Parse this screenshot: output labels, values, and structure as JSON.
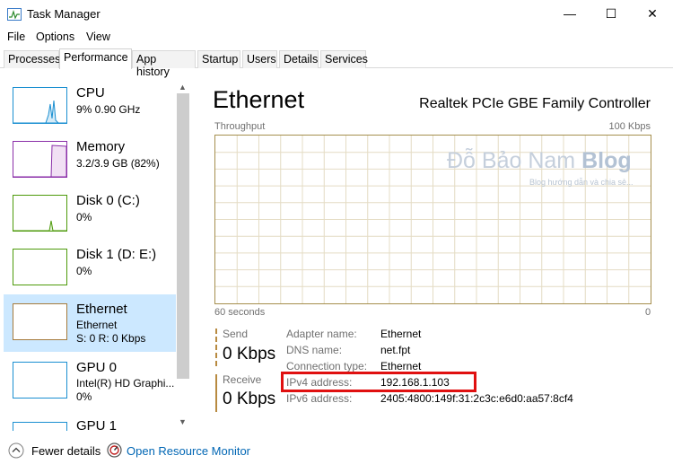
{
  "window": {
    "title": "Task Manager",
    "controls": {
      "minimize": "—",
      "maximize": "☐",
      "close": "✕"
    }
  },
  "menu": [
    "File",
    "Options",
    "View"
  ],
  "tabs": [
    {
      "label": "Processes",
      "active": false
    },
    {
      "label": "Performance",
      "active": true
    },
    {
      "label": "App history",
      "active": false
    },
    {
      "label": "Startup",
      "active": false
    },
    {
      "label": "Users",
      "active": false
    },
    {
      "label": "Details",
      "active": false
    },
    {
      "label": "Services",
      "active": false
    }
  ],
  "sidebar": {
    "items": [
      {
        "name": "CPU",
        "sub1": "9% 0.90 GHz",
        "sub2": "",
        "color": "#1a8fd1",
        "usage": 0.09
      },
      {
        "name": "Memory",
        "sub1": "3.2/3.9 GB (82%)",
        "sub2": "",
        "color": "#8a2ea8",
        "usage": 0.82
      },
      {
        "name": "Disk 0 (C:)",
        "sub1": "0%",
        "sub2": "",
        "color": "#4d9a0a",
        "usage": 0
      },
      {
        "name": "Disk 1 (D: E:)",
        "sub1": "0%",
        "sub2": "",
        "color": "#4d9a0a",
        "usage": 0
      },
      {
        "name": "Ethernet",
        "sub1": "Ethernet",
        "sub2": "S: 0 R: 0 Kbps",
        "color": "#a57a3c",
        "selected": true
      },
      {
        "name": "GPU 0",
        "sub1": "Intel(R) HD Graphi...",
        "sub2": "0%",
        "color": "#1a8fd1",
        "usage": 0
      },
      {
        "name": "GPU 1",
        "sub1": "",
        "sub2": "",
        "color": "#1a8fd1",
        "usage": 0
      }
    ]
  },
  "panel": {
    "title": "Ethernet",
    "device": "Realtek PCIe GBE Family Controller",
    "graph_label": "Throughput",
    "graph_max": "100 Kbps",
    "graph_time": "60 seconds",
    "graph_min": "0",
    "graph_color": "#a58f4d"
  },
  "watermark": {
    "name_light": "Đỗ Bảo Nam",
    "name_bold": "Blog",
    "tagline": "Blog hướng dẫn và chia sẻ..."
  },
  "stats": {
    "send_label": "Send",
    "send_value": "0 Kbps",
    "receive_label": "Receive",
    "receive_value": "0 Kbps"
  },
  "details": [
    {
      "label": "Adapter name:",
      "value": "Ethernet"
    },
    {
      "label": "DNS name:",
      "value": "net.fpt"
    },
    {
      "label": "Connection type:",
      "value": "Ethernet"
    },
    {
      "label": "IPv4 address:",
      "value": "192.168.1.103"
    },
    {
      "label": "IPv6 address:",
      "value": "2405:4800:149f:31:2c3c:e6d0:aa57:8cf4"
    }
  ],
  "footer": {
    "fewer_details": "Fewer details",
    "open_monitor": "Open Resource Monitor"
  }
}
